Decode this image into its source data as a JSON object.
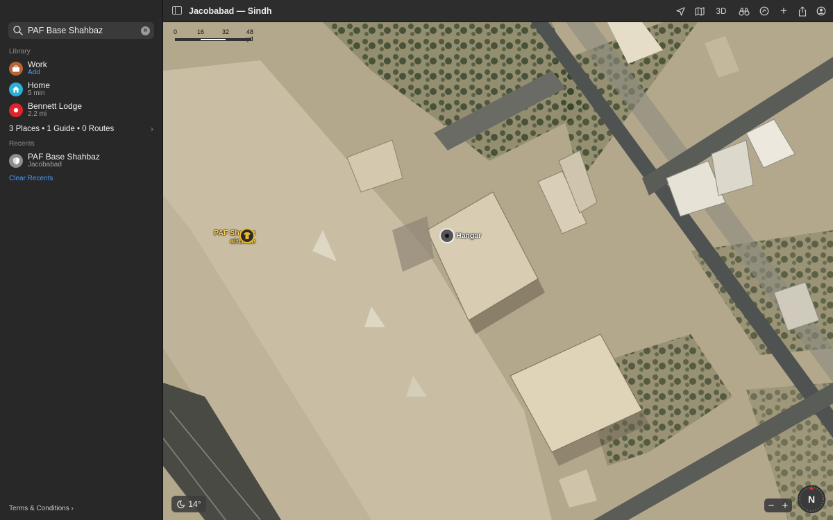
{
  "search": {
    "value": "PAF Base Shahbaz",
    "icon": "magnifier-icon"
  },
  "library": {
    "title": "Library",
    "items": [
      {
        "label": "Work",
        "sub": "Add",
        "icon": "briefcase-icon",
        "color": "#b5653a"
      },
      {
        "label": "Home",
        "sub": "5 min",
        "icon": "house-icon",
        "color": "#2ab0d6"
      },
      {
        "label": "Bennett Lodge",
        "sub": "2.2 mi",
        "icon": "pin-icon",
        "color": "#e0242b"
      }
    ],
    "summary": "3 Places • 1 Guide • 0 Routes"
  },
  "recents": {
    "title": "Recents",
    "items": [
      {
        "label": "PAF Base Shahbaz",
        "sub": "Jacobabad",
        "icon": "shield-icon"
      }
    ],
    "clear_label": "Clear Recents"
  },
  "footer": {
    "terms": "Terms & Conditions"
  },
  "toolbar": {
    "title": "Jacobabad — Sindh",
    "btn_3d": "3D"
  },
  "map": {
    "scale": {
      "l0": "0",
      "l1": "16",
      "l2": "32",
      "l3": "48 yd"
    },
    "poi_airbase": {
      "line1": "PAF Shabaz",
      "line2": "airbase"
    },
    "poi_hangar": "Hangar",
    "weather": "14°",
    "compass": "N",
    "zoom_out": "−",
    "zoom_in": "+"
  },
  "colors": {
    "accent": "#4a9cff",
    "poi_label": "#ffd75e"
  }
}
